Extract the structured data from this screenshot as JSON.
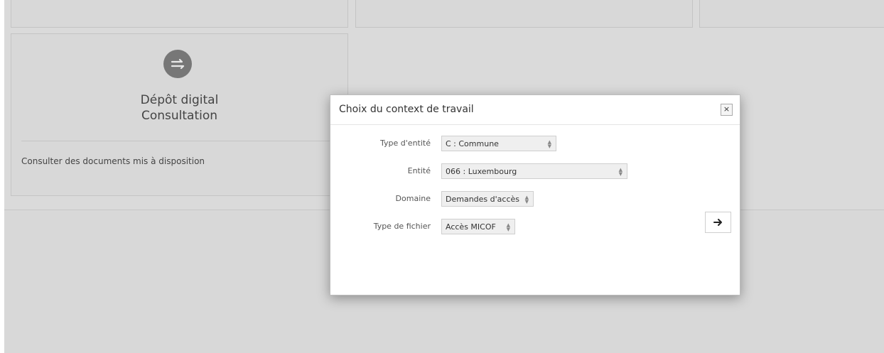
{
  "card": {
    "title_line1": "Dépôt digital",
    "title_line2": "Consultation",
    "description": "Consulter des documents mis à disposition",
    "icon": "transfer-arrows-icon"
  },
  "modal": {
    "title": "Choix du context de travail",
    "close_label": "×",
    "fields": [
      {
        "label": "Type d'entité",
        "value": "C : Commune"
      },
      {
        "label": "Entité",
        "value": "066 : Luxembourg"
      },
      {
        "label": "Domaine",
        "value": "Demandes d'accès"
      },
      {
        "label": "Type de fichier",
        "value": "Accès MICOF"
      }
    ],
    "submit_icon": "arrow-right-icon"
  }
}
